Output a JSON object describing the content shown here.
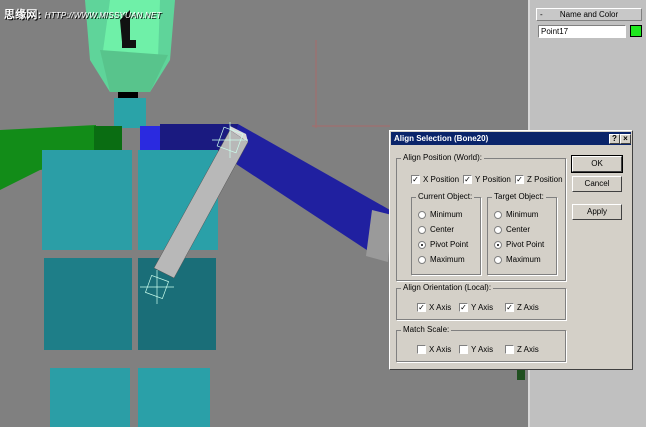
{
  "watermark": {
    "brand": "思缘网:",
    "url": "HTTP://WWW.MISSYUAN.NET"
  },
  "command_panel": {
    "rollout_title": "Name and Color",
    "rollout_toggle": "-",
    "object_name": "Point17",
    "object_color": "#1ee81e"
  },
  "dialog": {
    "title": "Align Selection (Bone20)",
    "help_label": "?",
    "close_label": "×",
    "align_position": {
      "title": "Align Position (World):",
      "x": {
        "label": "X Position",
        "checked": true
      },
      "y": {
        "label": "Y Position",
        "checked": true
      },
      "z": {
        "label": "Z Position",
        "checked": true
      }
    },
    "current_object": {
      "title": "Current Object:",
      "options": [
        "Minimum",
        "Center",
        "Pivot Point",
        "Maximum"
      ],
      "selected": "Pivot Point"
    },
    "target_object": {
      "title": "Target Object:",
      "options": [
        "Minimum",
        "Center",
        "Pivot Point",
        "Maximum"
      ],
      "selected": "Pivot Point"
    },
    "align_orientation": {
      "title": "Align Orientation (Local):",
      "x": {
        "label": "X Axis",
        "checked": true
      },
      "y": {
        "label": "Y Axis",
        "checked": true
      },
      "z": {
        "label": "Z Axis",
        "checked": true
      }
    },
    "match_scale": {
      "title": "Match Scale:",
      "x": {
        "label": "X Axis",
        "checked": false
      },
      "y": {
        "label": "Y Axis",
        "checked": false
      },
      "z": {
        "label": "Z Axis",
        "checked": false
      }
    },
    "buttons": {
      "ok": "OK",
      "cancel": "Cancel",
      "apply": "Apply"
    }
  }
}
